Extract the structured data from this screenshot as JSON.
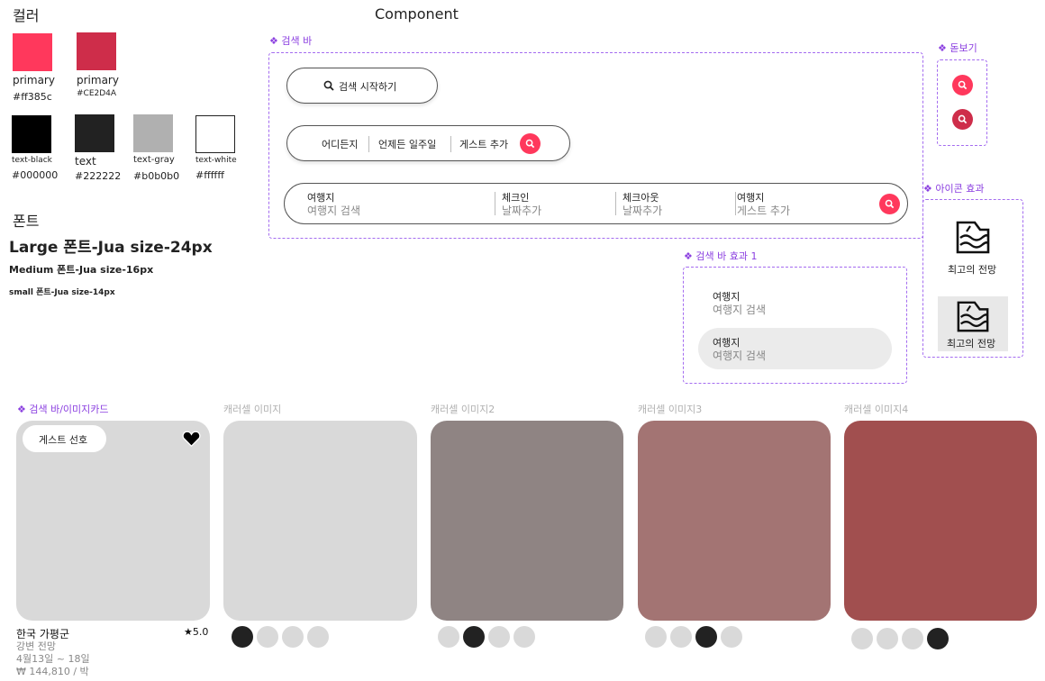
{
  "colors": {
    "title": "컬러",
    "swatches": [
      {
        "name": "primary",
        "hex": "#ff385c",
        "color": "#ff385c"
      },
      {
        "name": "primary",
        "hex": "#CE2D4A",
        "color": "#CE2D4A"
      },
      {
        "name": "text-black",
        "hex": "#000000",
        "color": "#000000"
      },
      {
        "name": "text",
        "hex": "#222222",
        "color": "#222222"
      },
      {
        "name": "text-gray",
        "hex": "#b0b0b0",
        "color": "#b0b0b0"
      },
      {
        "name": "text-white",
        "hex": "#ffffff",
        "color": "#ffffff"
      }
    ]
  },
  "fonts": {
    "title": "폰트",
    "large": "Large 폰트-Jua size-24px",
    "medium": "Medium  폰트-Jua  size-16px",
    "small": "small  폰트-Jua  size-14px"
  },
  "component": {
    "title": "Component",
    "searchbar": {
      "label": "❖ 검색 바",
      "start": "검색 시작하기",
      "mini": [
        "어디든지",
        "언제든 일주일",
        "게스트 추가"
      ],
      "full": [
        {
          "label": "여행지",
          "value": "여행지 검색"
        },
        {
          "label": "체크인",
          "value": "날짜추가"
        },
        {
          "label": "체크아웃",
          "value": "날짜추가"
        },
        {
          "label": "여행지",
          "value": "게스트 추가"
        }
      ]
    },
    "magnifier": {
      "label": "❖ 돋보기"
    },
    "searchbar_effect": {
      "label": "❖ 검색 바 효과 1",
      "items": [
        {
          "label": "여행지",
          "value": "여행지 검색"
        },
        {
          "label": "여행지",
          "value": "여행지 검색"
        }
      ]
    },
    "icon_effect": {
      "label": "❖ 아이콘 효과",
      "caption": "최고의 전망"
    }
  },
  "cards": {
    "label": "❖ 검색 바/이미지카드",
    "badge": "게스트 선호",
    "location": "한국 가평군",
    "rating": "★5.0",
    "view": "강변 전망",
    "dates": "4월13일 ~ 18일",
    "price": "₩ 144,810 / 박",
    "carousels": [
      {
        "label": "캐러셀 이미지",
        "color": "#d9d9d9",
        "active": 0
      },
      {
        "label": "캐러셀 이미지2",
        "color": "#8f8483",
        "active": 1
      },
      {
        "label": "캐러셀 이미지3",
        "color": "#a37473",
        "active": 2
      },
      {
        "label": "캐러셀 이미지4",
        "color": "#a14f4f",
        "active": 3
      }
    ]
  }
}
